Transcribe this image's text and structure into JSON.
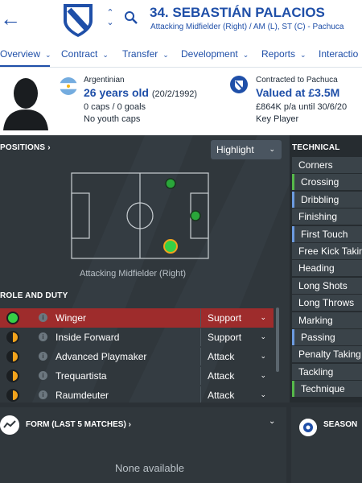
{
  "header": {
    "player_name": "34. SEBASTIÁN PALACIOS",
    "positions": "Attacking Midfielder (Right) / AM (L), ST (C) - Pachuca",
    "icons": {
      "back": "back-arrow-icon",
      "crest": "club-crest-icon",
      "nav": "up-down-arrows-icon",
      "search": "search-icon"
    }
  },
  "tabs": [
    {
      "label": "Overview"
    },
    {
      "label": "Contract"
    },
    {
      "label": "Transfer"
    },
    {
      "label": "Development"
    },
    {
      "label": "Reports"
    },
    {
      "label": "Interactio"
    }
  ],
  "info": {
    "nationality": "Argentinian",
    "age": "26 years old",
    "dob": "(20/2/1992)",
    "caps": "0 caps / 0 goals",
    "youth_caps": "No youth caps",
    "contracted_to": "Contracted to Pachuca",
    "valued": "Valued at £3.5M",
    "wage": "£864K p/a until 30/6/20",
    "status": "Key Player"
  },
  "positions_panel": {
    "title": "POSITIONS",
    "highlight_label": "Highlight",
    "position_caption": "Attacking Midfielder (Right)"
  },
  "role_duty": {
    "title": "ROLE AND DUTY",
    "rows": [
      {
        "role": "Winger",
        "duty": "Support",
        "selected": true,
        "suitability": "green"
      },
      {
        "role": "Inside Forward",
        "duty": "Support",
        "selected": false,
        "suitability": "half"
      },
      {
        "role": "Advanced Playmaker",
        "duty": "Attack",
        "selected": false,
        "suitability": "half"
      },
      {
        "role": "Trequartista",
        "duty": "Attack",
        "selected": false,
        "suitability": "half"
      },
      {
        "role": "Raumdeuter",
        "duty": "Attack",
        "selected": false,
        "suitability": "half"
      }
    ]
  },
  "technical": {
    "title": "TECHNICAL",
    "attributes": [
      {
        "label": "Corners",
        "highlight": ""
      },
      {
        "label": "Crossing",
        "highlight": "green"
      },
      {
        "label": "Dribbling",
        "highlight": "blue"
      },
      {
        "label": "Finishing",
        "highlight": ""
      },
      {
        "label": "First Touch",
        "highlight": "blue"
      },
      {
        "label": "Free Kick Taking",
        "highlight": ""
      },
      {
        "label": "Heading",
        "highlight": ""
      },
      {
        "label": "Long Shots",
        "highlight": ""
      },
      {
        "label": "Long Throws",
        "highlight": ""
      },
      {
        "label": "Marking",
        "highlight": ""
      },
      {
        "label": "Passing",
        "highlight": "blue"
      },
      {
        "label": "Penalty Taking",
        "highlight": ""
      },
      {
        "label": "Tackling",
        "highlight": ""
      },
      {
        "label": "Technique",
        "highlight": "green"
      }
    ]
  },
  "form": {
    "title": "FORM (LAST 5 MATCHES)",
    "empty_text": "None available"
  },
  "season": {
    "title": "SEASON"
  },
  "colors": {
    "brand_blue": "#1f4fa8",
    "selected_row": "#9e2c2c",
    "suitability_green": "#35d046",
    "suitability_orange": "#f2a31c"
  }
}
